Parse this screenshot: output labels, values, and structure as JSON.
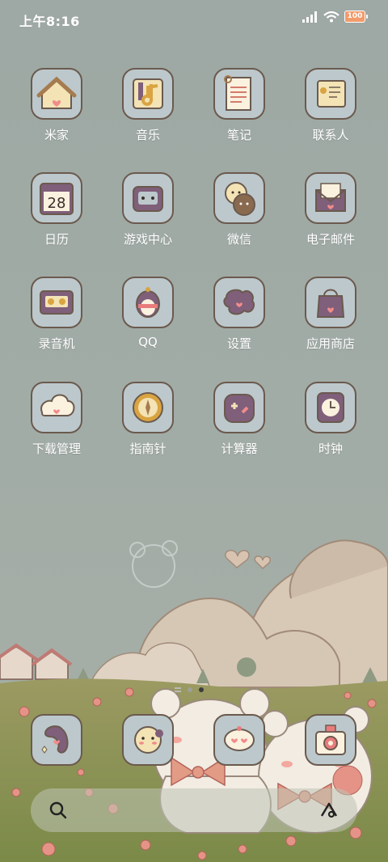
{
  "status_bar": {
    "time": "上午8:16",
    "battery": "100",
    "icons": [
      "signal-icon",
      "wifi-icon",
      "battery-icon"
    ]
  },
  "apps": [
    {
      "label": "米家",
      "icon": "home-icon"
    },
    {
      "label": "音乐",
      "icon": "music-icon"
    },
    {
      "label": "笔记",
      "icon": "notes-icon"
    },
    {
      "label": "联系人",
      "icon": "contacts-icon"
    },
    {
      "label": "日历",
      "icon": "calendar-icon",
      "day": "28"
    },
    {
      "label": "游戏中心",
      "icon": "game-icon"
    },
    {
      "label": "微信",
      "icon": "wechat-icon"
    },
    {
      "label": "电子邮件",
      "icon": "email-icon"
    },
    {
      "label": "录音机",
      "icon": "recorder-icon"
    },
    {
      "label": "QQ",
      "icon": "qq-icon"
    },
    {
      "label": "设置",
      "icon": "settings-icon"
    },
    {
      "label": "应用商店",
      "icon": "app-store-icon"
    },
    {
      "label": "下载管理",
      "icon": "download-icon"
    },
    {
      "label": "指南针",
      "icon": "compass-icon"
    },
    {
      "label": "计算器",
      "icon": "calculator-icon"
    },
    {
      "label": "时钟",
      "icon": "clock-icon"
    }
  ],
  "dock": [
    {
      "icon": "phone-icon"
    },
    {
      "icon": "messages-icon"
    },
    {
      "icon": "chat-bubble-icon"
    },
    {
      "icon": "camera-icon"
    }
  ],
  "page_indicator": {
    "pages": 2,
    "active": 2
  },
  "search_bar": {
    "icons": [
      "search-icon",
      "assistant-icon"
    ]
  },
  "colors": {
    "tile_bg": "#bcc8cc",
    "tile_border": "#6b5a4e",
    "purple": "#7f5f7a",
    "yellow": "#f3e3b5",
    "pink": "#f28b8b",
    "sky": "#9fa8a3"
  }
}
